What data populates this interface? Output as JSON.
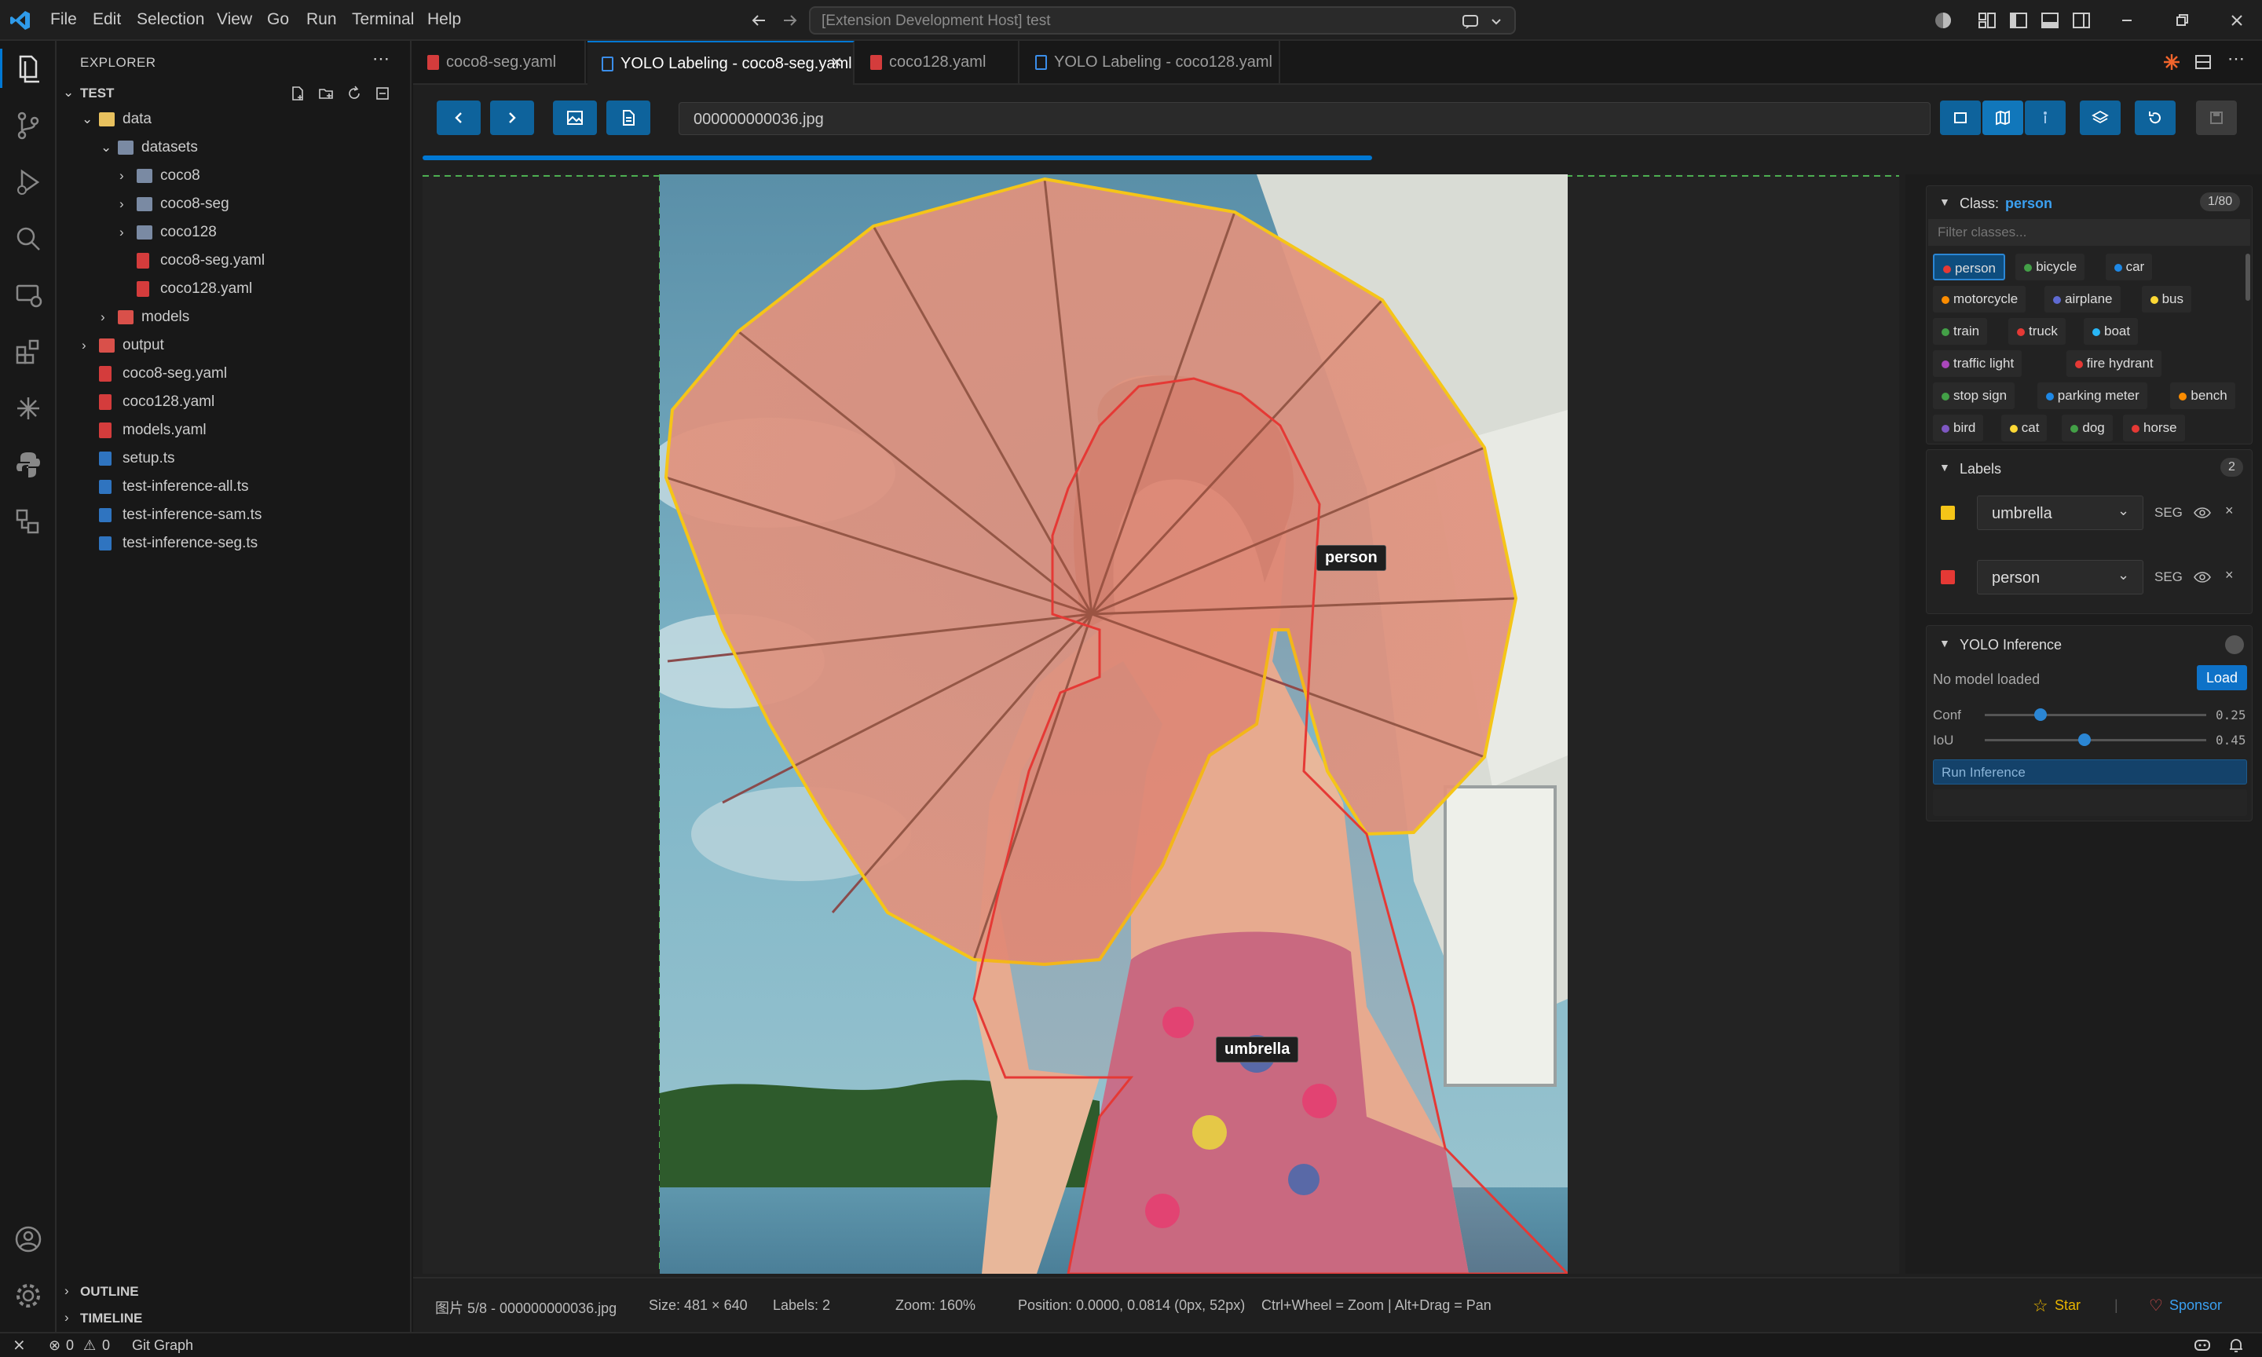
{
  "menu": [
    "File",
    "Edit",
    "Selection",
    "View",
    "Go",
    "Run",
    "Terminal",
    "Help"
  ],
  "command_center": "[Extension Development Host] test",
  "sidebar": {
    "title": "EXPLORER",
    "root": "TEST",
    "tree": [
      {
        "label": "data",
        "depth": 1,
        "kind": "folder-open",
        "open": true
      },
      {
        "label": "datasets",
        "depth": 2,
        "kind": "folder",
        "open": true
      },
      {
        "label": "coco8",
        "depth": 3,
        "kind": "folder",
        "open": false
      },
      {
        "label": "coco8-seg",
        "depth": 3,
        "kind": "folder",
        "open": false
      },
      {
        "label": "coco128",
        "depth": 3,
        "kind": "folder",
        "open": false
      },
      {
        "label": "coco8-seg.yaml",
        "depth": 3,
        "kind": "yaml"
      },
      {
        "label": "coco128.yaml",
        "depth": 3,
        "kind": "yaml"
      },
      {
        "label": "models",
        "depth": 2,
        "kind": "folder-red",
        "open": false
      },
      {
        "label": "output",
        "depth": 1,
        "kind": "folder-red",
        "open": false
      },
      {
        "label": "coco8-seg.yaml",
        "depth": 1,
        "kind": "yaml"
      },
      {
        "label": "coco128.yaml",
        "depth": 1,
        "kind": "yaml"
      },
      {
        "label": "models.yaml",
        "depth": 1,
        "kind": "yaml"
      },
      {
        "label": "setup.ts",
        "depth": 1,
        "kind": "ts"
      },
      {
        "label": "test-inference-all.ts",
        "depth": 1,
        "kind": "ts"
      },
      {
        "label": "test-inference-sam.ts",
        "depth": 1,
        "kind": "ts"
      },
      {
        "label": "test-inference-seg.ts",
        "depth": 1,
        "kind": "ts"
      }
    ],
    "outline": "OUTLINE",
    "timeline": "TIMELINE"
  },
  "tabs": [
    {
      "label": "coco8-seg.yaml",
      "kind": "yaml",
      "active": false
    },
    {
      "label": "YOLO Labeling - coco8-seg.yaml",
      "kind": "preview",
      "active": true
    },
    {
      "label": "coco128.yaml",
      "kind": "yaml",
      "active": false
    },
    {
      "label": "YOLO Labeling - coco128.yaml",
      "kind": "preview",
      "active": false
    }
  ],
  "toolbar": {
    "prev": "<",
    "next": ">",
    "filename": "000000000036.jpg",
    "progress": 0.625
  },
  "canvas_labels": {
    "person": "person",
    "umbrella": "umbrella"
  },
  "class_panel": {
    "title_prefix": "Class:",
    "current": "person",
    "count": "1/80",
    "filter_placeholder": "Filter classes...",
    "classes": [
      {
        "name": "person",
        "color": "#e53935",
        "selected": true
      },
      {
        "name": "bicycle",
        "color": "#43a047"
      },
      {
        "name": "car",
        "color": "#1e88e5"
      },
      {
        "name": "motorcycle",
        "color": "#fb8c00"
      },
      {
        "name": "airplane",
        "color": "#5e6ad2"
      },
      {
        "name": "bus",
        "color": "#fdd835"
      },
      {
        "name": "train",
        "color": "#43a047"
      },
      {
        "name": "truck",
        "color": "#e53935"
      },
      {
        "name": "boat",
        "color": "#29b6f6"
      },
      {
        "name": "traffic light",
        "color": "#ab47bc"
      },
      {
        "name": "fire hydrant",
        "color": "#e53935"
      },
      {
        "name": "stop sign",
        "color": "#43a047"
      },
      {
        "name": "parking meter",
        "color": "#1e88e5"
      },
      {
        "name": "bench",
        "color": "#fb8c00"
      },
      {
        "name": "bird",
        "color": "#7e57c2"
      },
      {
        "name": "cat",
        "color": "#fdd835"
      },
      {
        "name": "dog",
        "color": "#43a047"
      },
      {
        "name": "horse",
        "color": "#e53935"
      }
    ]
  },
  "labels_panel": {
    "title": "Labels",
    "count": "2",
    "items": [
      {
        "class": "umbrella",
        "type": "SEG",
        "color": "#f5c518"
      },
      {
        "class": "person",
        "type": "SEG",
        "color": "#e53935"
      }
    ]
  },
  "inference_panel": {
    "title": "YOLO Inference",
    "model_status": "No model loaded",
    "load": "Load",
    "conf_label": "Conf",
    "conf_value": "0.25",
    "iou_label": "IoU",
    "iou_value": "0.45",
    "run": "Run Inference"
  },
  "footer": {
    "image_index": "图片 5/8 - 000000000036.jpg",
    "size": "Size: 481 × 640",
    "labels": "Labels: 2",
    "zoom": "Zoom: 160%",
    "position": "Position: 0.0000, 0.0814 (0px, 52px)",
    "hint": "Ctrl+Wheel = Zoom | Alt+Drag = Pan",
    "star": "Star",
    "sponsor": "Sponsor"
  },
  "statusbar": {
    "errors": "0",
    "warnings": "0",
    "git_graph": "Git Graph"
  },
  "colors": {
    "accent": "#0078d4",
    "button": "#0e639c",
    "umbrella_outline": "#f5c518",
    "person_outline": "#e53935"
  }
}
